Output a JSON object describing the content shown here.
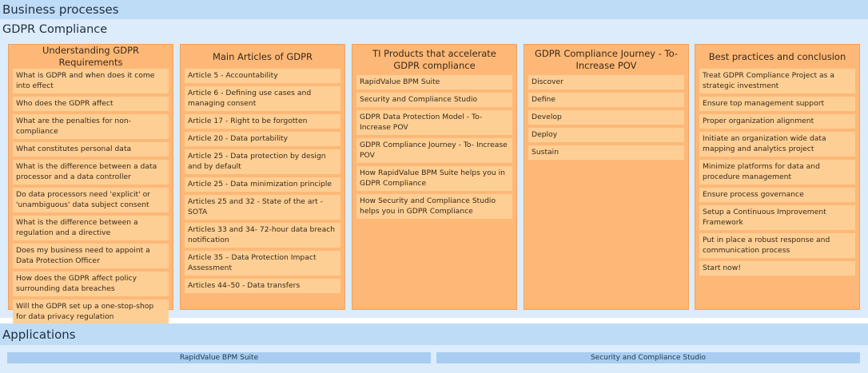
{
  "business_processes_title": "Business processes",
  "gdpr_title": "GDPR Compliance",
  "columns": [
    {
      "title": "Understanding GDPR Requirements",
      "cards": [
        "What is GDPR and when does it come into effect",
        "Who does the GDPR affect",
        "What are the penalties for non-compliance",
        "What constitutes personal data",
        "What is the difference between a data processor and a data controller",
        "Do data processors need 'explicit' or 'unambiguous' data subject consent",
        "What is the difference between a regulation and a directive",
        "Does my business need to appoint a Data Protection Officer",
        "How does the GDPR affect policy surrounding data breaches",
        "Will the GDPR set up a one-stop-shop for data privacy regulation"
      ]
    },
    {
      "title": "Main Articles of GDPR",
      "cards": [
        "Article 5 - Accountability",
        "Article 6 - Defining use cases and managing consent",
        "Article 17 - Right to be forgotten",
        "Article 20 - Data portability",
        "Article 25 - Data protection by design and by default",
        "Article 25 - Data minimization principle",
        "Articles 25 and 32 - State of the art - SOTA",
        "Articles 33 and 34- 72-hour data breach notification",
        "Article 35 – Data Protection Impact Assessment",
        "Articles 44–50 - Data transfers"
      ]
    },
    {
      "title": "TI Products that accelerate GDPR compliance",
      "cards": [
        "RapidValue BPM Suite",
        "Security and Compliance Studio",
        "GDPR Data Protection Model - To- Increase POV",
        "GDPR Compliance Journey - To- Increase POV",
        "How RapidValue BPM Suite helps you in GDPR Compliance",
        "How Security and Compliance Studio helps you in GDPR Compliance"
      ]
    },
    {
      "title": "GDPR Compliance Journey - To- Increase POV",
      "cards": [
        "Discover",
        "Define",
        "Develop",
        "Deploy",
        "Sustain"
      ]
    },
    {
      "title": "Best practices and conclusion",
      "cards": [
        "Treat GDPR Compliance Project as a strategic investment",
        "Ensure top management support",
        "Proper organization alignment",
        "Initiate an organization wide data mapping and analytics project",
        "Minimize platforms for data and procedure management",
        "Ensure process governance",
        "Setup a Continuous Improvement Framework",
        "Put in place a robust response and communication process",
        "Start now!"
      ]
    }
  ],
  "applications_title": "Applications",
  "applications": [
    "RapidValue BPM Suite",
    "Security and Compliance Studio"
  ]
}
